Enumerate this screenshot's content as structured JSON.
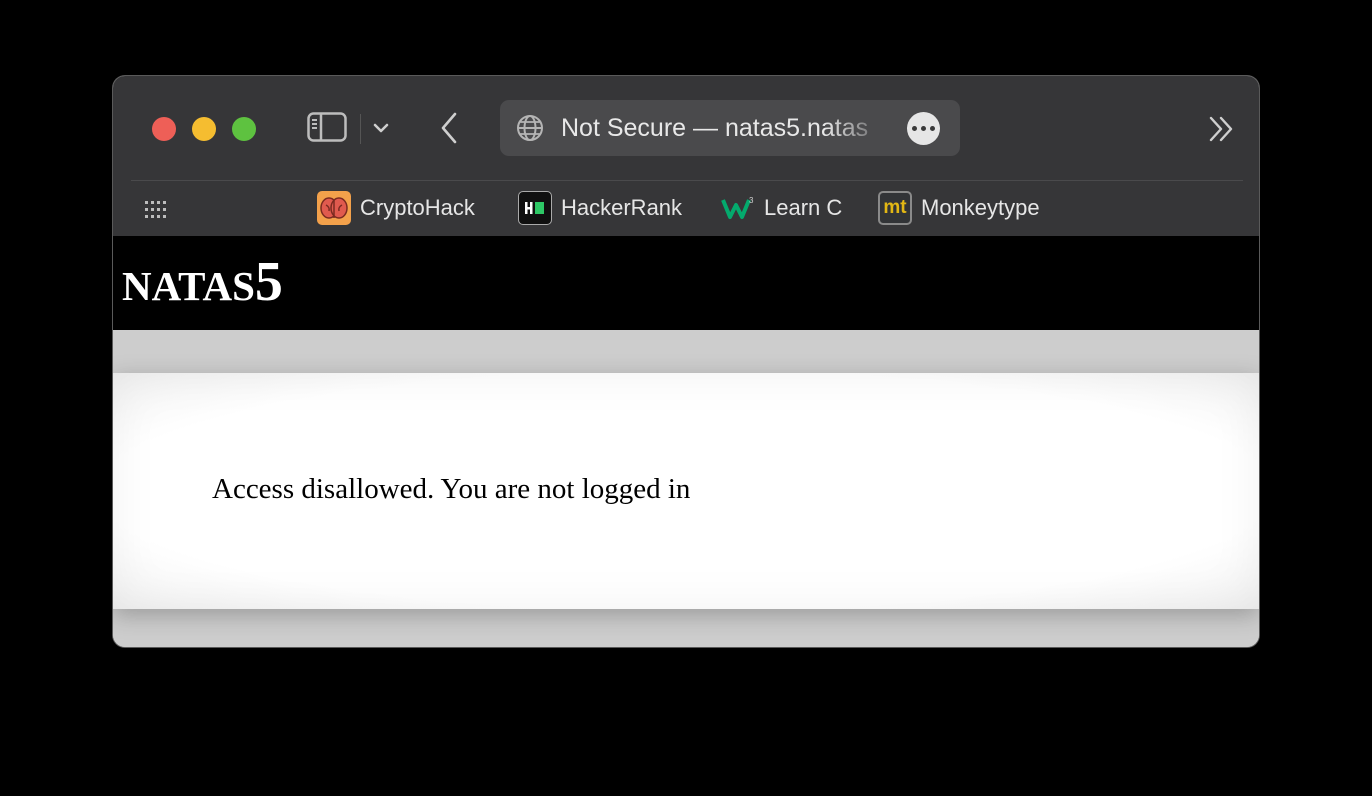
{
  "browser": {
    "url_display": "Not Secure — natas5.natas",
    "bookmarks": [
      {
        "label": "CryptoHack",
        "icon": "cryptohack-brain-icon"
      },
      {
        "label": "HackerRank",
        "icon": "hackerrank-icon"
      },
      {
        "label": "Learn C",
        "icon": "w3schools-icon"
      },
      {
        "label": "Monkeytype",
        "icon": "monkeytype-icon",
        "icon_text": "mt"
      }
    ]
  },
  "page": {
    "title_prefix": "NATAS",
    "title_number": "5",
    "message": "Access disallowed. You are not logged in"
  }
}
